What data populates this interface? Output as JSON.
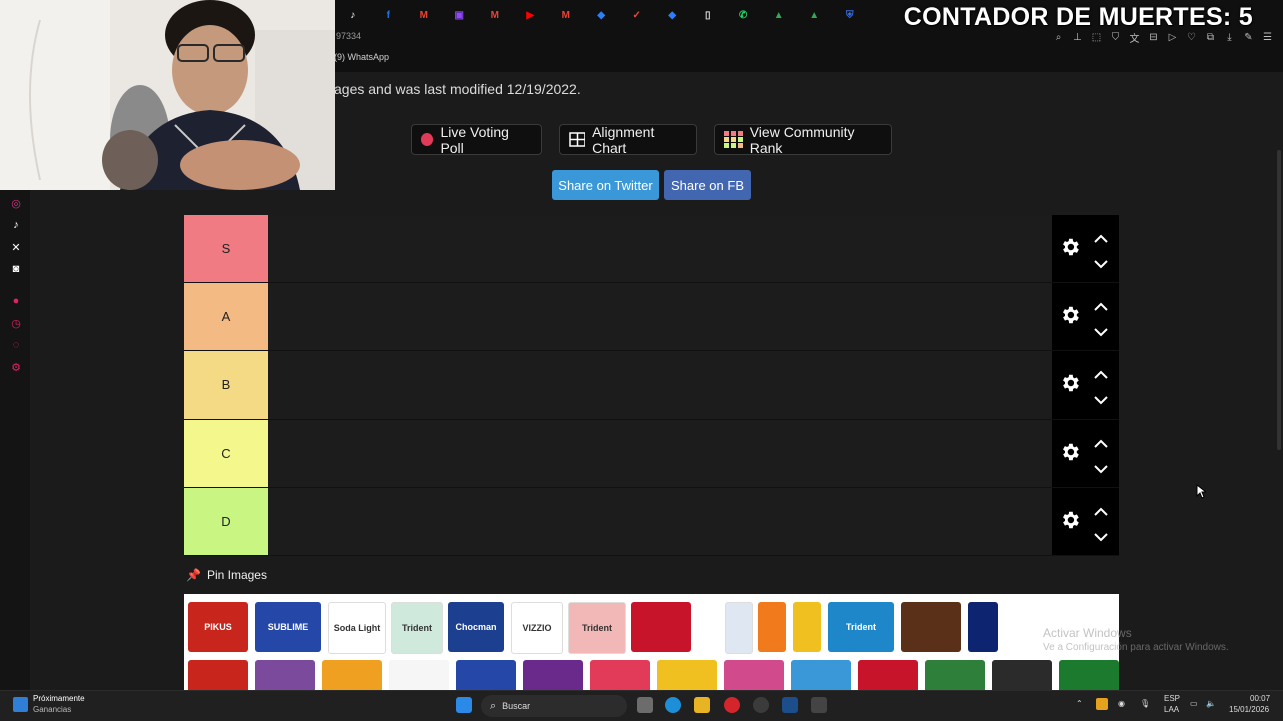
{
  "overlay": {
    "counter_text": "CONTADOR DE MUERTES: 5"
  },
  "browser": {
    "url_fragment": "97334",
    "bookmark": "(9) WhatsApp",
    "tab_icons": [
      "tiktok",
      "facebook",
      "gmail",
      "twitch",
      "gmail",
      "youtube",
      "gmail",
      "app",
      "check",
      "app",
      "file",
      "whatsapp",
      "drive",
      "drive",
      "shield"
    ]
  },
  "page": {
    "modified_text": "ages and was last modified 12/19/2022.",
    "buttons": {
      "live_poll": "Live Voting Poll",
      "alignment_chart": "Alignment Chart",
      "community_rank": "View Community Rank"
    },
    "share": {
      "twitter": "Share on Twitter",
      "fb": "Share on FB"
    },
    "tiers": [
      {
        "label": "S",
        "color": "#f07b83"
      },
      {
        "label": "A",
        "color": "#f4ba83"
      },
      {
        "label": "B",
        "color": "#f5da86"
      },
      {
        "label": "C",
        "color": "#f4f78c"
      },
      {
        "label": "D",
        "color": "#c9f582"
      }
    ],
    "pin_label": "Pin Images",
    "pool_items": [
      {
        "name": "PIKUS",
        "color": "#c8251d"
      },
      {
        "name": "SUBLIME",
        "color": "#2447a8"
      },
      {
        "name": "Soda Light",
        "color": "#ffffff"
      },
      {
        "name": "Trident",
        "color": "#cfe9dd"
      },
      {
        "name": "Chocman",
        "color": "#1d3f8f"
      },
      {
        "name": "VIZZIO",
        "color": "#ffffff"
      },
      {
        "name": "Trident",
        "color": "#f2b7b7"
      },
      {
        "name": "",
        "color": "#c8142a"
      },
      {
        "name": "",
        "color": "#dfe8f2"
      },
      {
        "name": "",
        "color": "#f07a1c"
      },
      {
        "name": "",
        "color": "#f0c020"
      },
      {
        "name": "Trident",
        "color": "#1e87c9"
      },
      {
        "name": "",
        "color": "#5a3018"
      },
      {
        "name": "",
        "color": "#0d2470"
      }
    ]
  },
  "windows": {
    "activate_title": "Activar Windows",
    "activate_sub": "Ve a Configuración para activar Windows."
  },
  "taskbar": {
    "widget_title": "Próximamente",
    "widget_sub": "Ganancias",
    "search_label": "Buscar",
    "lang_1": "ESP",
    "lang_2": "LAA",
    "time": "00:07",
    "date": "15/01/2026"
  }
}
